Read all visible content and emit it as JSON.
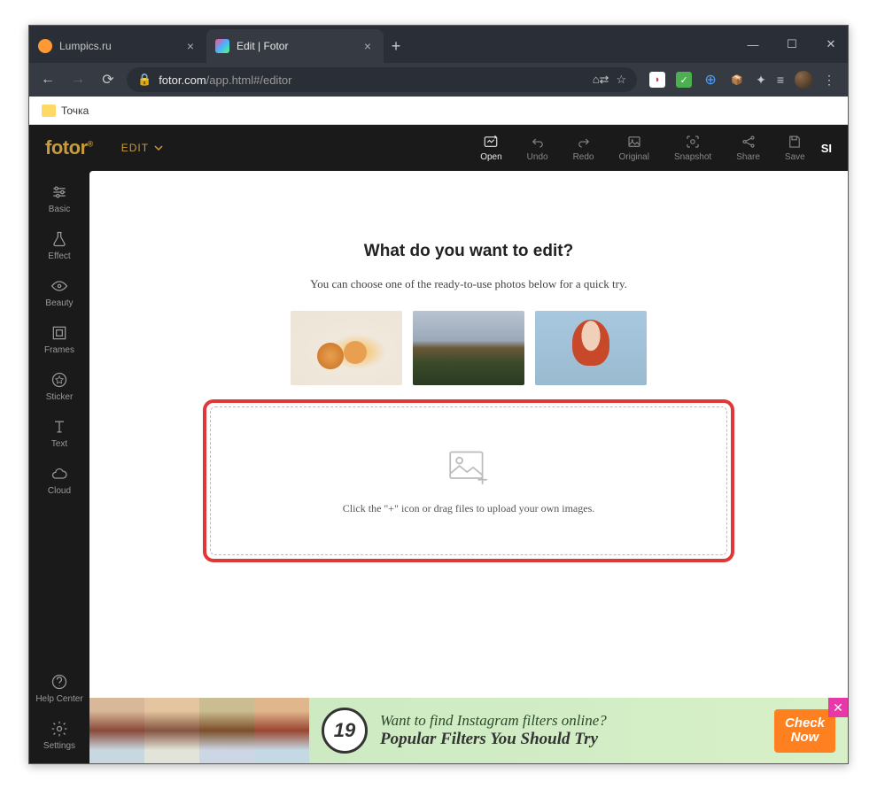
{
  "browser": {
    "tabs": [
      {
        "title": "Lumpics.ru",
        "active": false
      },
      {
        "title": "Edit | Fotor",
        "active": true
      }
    ],
    "url_domain": "fotor.com",
    "url_path": "/app.html#/editor",
    "bookmark": "Точка"
  },
  "app": {
    "logo": "fotor",
    "mode": "EDIT",
    "topbar": {
      "open": "Open",
      "undo": "Undo",
      "redo": "Redo",
      "original": "Original",
      "snapshot": "Snapshot",
      "share": "Share",
      "save": "Save"
    },
    "signin_fragment": "SI",
    "sidebar": {
      "basic": "Basic",
      "effect": "Effect",
      "beauty": "Beauty",
      "frames": "Frames",
      "sticker": "Sticker",
      "text": "Text",
      "cloud": "Cloud",
      "help": "Help Center",
      "settings": "Settings"
    },
    "canvas": {
      "heading": "What do you want to edit?",
      "subheading": "You can choose one of the ready-to-use photos below for a quick try.",
      "dropzone": "Click the \"+\" icon or drag files to upload your own images."
    },
    "banner": {
      "badge": "19",
      "line1": "Want to find Instagram filters online?",
      "line2": "Popular Filters You Should Try",
      "cta_1": "Check",
      "cta_2": "Now"
    }
  }
}
